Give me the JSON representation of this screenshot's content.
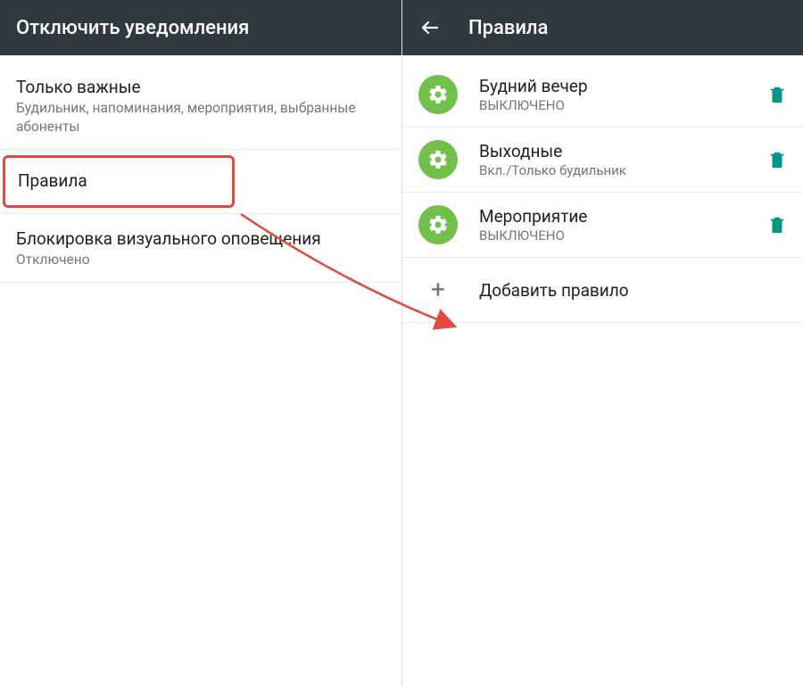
{
  "left": {
    "header_title": "Отключить уведомления",
    "items": [
      {
        "title": "Только важные",
        "sub": "Будильник, напоминания, мероприятия, выбранные абоненты"
      },
      {
        "title": "Правила",
        "sub": ""
      },
      {
        "title": "Блокировка визуального оповещения",
        "sub": "Отключено"
      }
    ]
  },
  "right": {
    "header_title": "Правила",
    "rules": [
      {
        "title": "Будний вечер",
        "sub": "ВЫКЛЮЧЕНО"
      },
      {
        "title": "Выходные",
        "sub": "Вкл./Только будильник"
      },
      {
        "title": "Мероприятие",
        "sub": "ВЫКЛЮЧЕНО"
      }
    ],
    "add_label": "Добавить правило"
  },
  "colors": {
    "header_bg": "#2e3a3d",
    "gear_bg": "#71c04b",
    "trash": "#009688",
    "highlight_border": "#e04a3f",
    "arrow": "#e04a3f"
  }
}
